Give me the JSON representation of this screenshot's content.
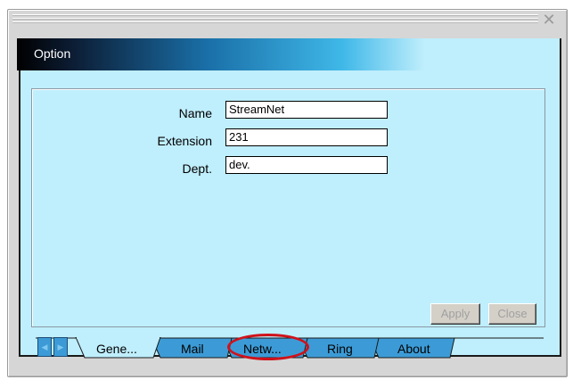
{
  "window": {
    "title": "Option",
    "close_glyph": "✕"
  },
  "form": {
    "name": {
      "label": "Name",
      "value": "StreamNet"
    },
    "extension": {
      "label": "Extension",
      "value": "231"
    },
    "dept": {
      "label": "Dept.",
      "value": "dev."
    }
  },
  "buttons": {
    "apply": "Apply",
    "close": "Close"
  },
  "tabs": [
    {
      "label": "Gene...",
      "active": true
    },
    {
      "label": "Mail",
      "active": false
    },
    {
      "label": "Netw...",
      "active": false,
      "highlighted": true
    },
    {
      "label": "Ring",
      "active": false
    },
    {
      "label": "About",
      "active": false
    }
  ],
  "colors": {
    "panel_bg": "#bfeefc",
    "tab_fill": "#3c9bd6",
    "highlight": "#d0121a"
  },
  "icons": [
    "close-icon",
    "scroll-left-icon",
    "scroll-right-icon"
  ]
}
